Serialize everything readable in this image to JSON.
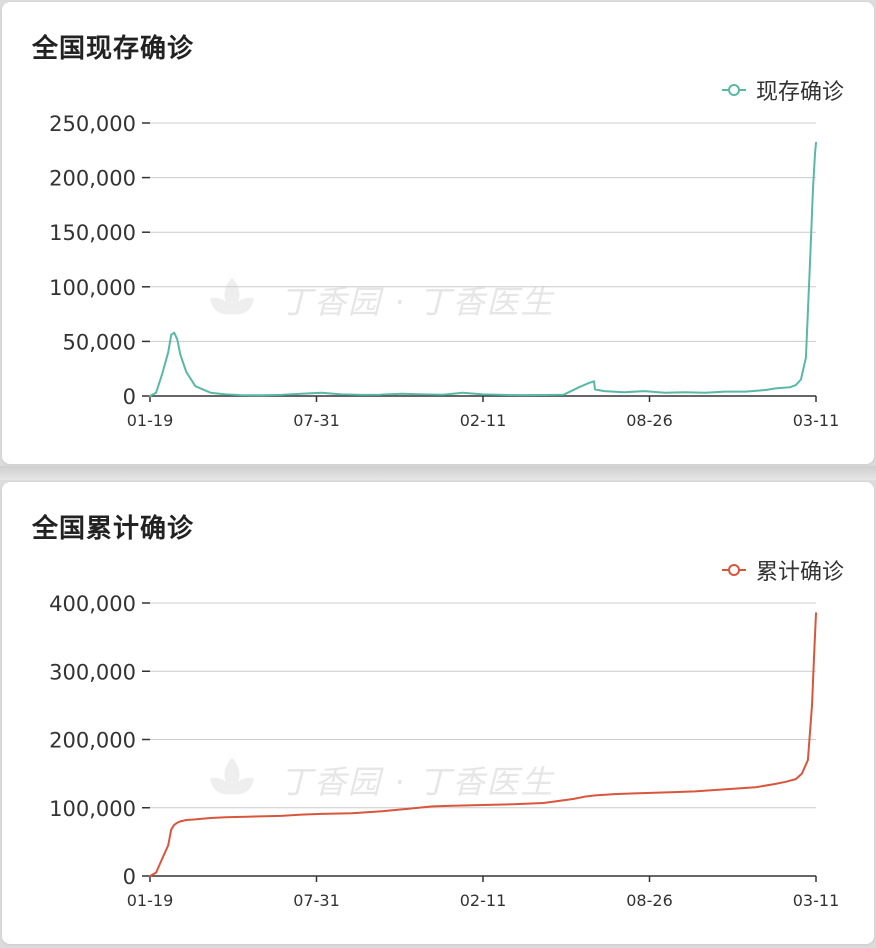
{
  "cards": [
    {
      "title": "全国现存确诊",
      "legend": "现存确诊",
      "color": "#5ab8a6"
    },
    {
      "title": "全国累计确诊",
      "legend": "累计确诊",
      "color": "#d9563c"
    }
  ],
  "watermark": "丁香园 · 丁香医生",
  "chart_data": [
    {
      "type": "line",
      "title": "全国现存确诊",
      "x_tick_labels": [
        "01-19",
        "07-31",
        "02-11",
        "08-26",
        "03-11"
      ],
      "ylim": [
        0,
        250000
      ],
      "y_ticks": [
        0,
        50000,
        100000,
        150000,
        200000,
        250000
      ],
      "y_tick_labels": [
        "0",
        "50,000",
        "100,000",
        "150,000",
        "200,000",
        "250,000"
      ],
      "grid": true,
      "legend_position": "top-right",
      "series": [
        {
          "name": "现存确诊",
          "color": "#5ab8a6",
          "x": [
            0,
            6,
            12,
            18,
            21,
            24,
            27,
            30,
            36,
            45,
            60,
            75,
            90,
            110,
            130,
            150,
            170,
            190,
            210,
            228,
            250,
            270,
            290,
            310,
            330,
            350,
            370,
            390,
            410,
            425,
            435,
            440,
            441,
            450,
            470,
            490,
            510,
            530,
            550,
            570,
            590,
            610,
            620,
            628,
            634,
            640,
            645,
            650,
            654,
            657,
            659,
            660
          ],
          "y": [
            0,
            3000,
            20000,
            40000,
            56000,
            58000,
            52000,
            38000,
            22000,
            9000,
            3000,
            1500,
            800,
            600,
            1000,
            2000,
            3000,
            1500,
            1000,
            1200,
            2000,
            1500,
            1200,
            3000,
            1500,
            1000,
            800,
            900,
            1200,
            8000,
            12000,
            13500,
            6000,
            4500,
            3500,
            4500,
            3000,
            3500,
            3000,
            4000,
            4000,
            5500,
            7000,
            7500,
            8000,
            10000,
            15000,
            35000,
            120000,
            190000,
            222000,
            232000
          ]
        }
      ]
    },
    {
      "type": "line",
      "title": "全国累计确诊",
      "x_tick_labels": [
        "01-19",
        "07-31",
        "02-11",
        "08-26",
        "03-11"
      ],
      "ylim": [
        0,
        400000
      ],
      "y_ticks": [
        0,
        100000,
        200000,
        300000,
        400000
      ],
      "y_tick_labels": [
        "0",
        "100,000",
        "200,000",
        "300,000",
        "400,000"
      ],
      "grid": true,
      "legend_position": "top-right",
      "series": [
        {
          "name": "累计确诊",
          "color": "#d9563c",
          "x": [
            0,
            6,
            12,
            18,
            21,
            24,
            27,
            30,
            36,
            45,
            60,
            75,
            100,
            130,
            150,
            170,
            200,
            230,
            260,
            280,
            300,
            330,
            360,
            390,
            420,
            430,
            440,
            460,
            480,
            500,
            520,
            540,
            560,
            580,
            600,
            620,
            630,
            640,
            646,
            652,
            656,
            658,
            660
          ],
          "y": [
            0,
            5000,
            25000,
            45000,
            68000,
            75000,
            78000,
            80000,
            82000,
            83000,
            85000,
            86000,
            87000,
            88000,
            90000,
            91000,
            92000,
            95000,
            99000,
            102000,
            103000,
            104000,
            105000,
            107000,
            113000,
            116000,
            118000,
            120000,
            121000,
            122000,
            123000,
            124000,
            126000,
            128000,
            130000,
            135000,
            138000,
            142000,
            150000,
            170000,
            250000,
            320000,
            385000
          ]
        }
      ]
    }
  ]
}
